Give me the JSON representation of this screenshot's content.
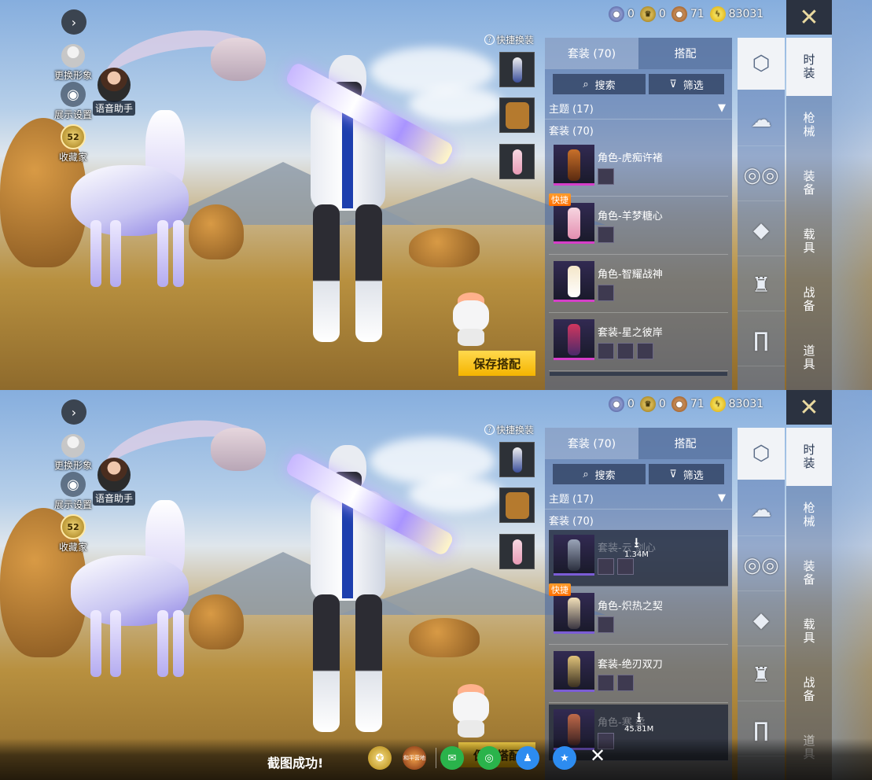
{
  "colors": {
    "accent_gold": "#f4b400",
    "panel_blue": "#48669e",
    "tag_orange": "#ff6d00",
    "rarity_pink": "#d63ec9",
    "rarity_purple": "#7b5cd6"
  },
  "top": {
    "currencies": [
      {
        "icon": "blue-coin-icon",
        "value": "0"
      },
      {
        "icon": "gold-medal-icon",
        "value": "0"
      },
      {
        "icon": "bronze-coin-icon",
        "value": "71"
      },
      {
        "icon": "lightning-coin-icon",
        "value": "83031"
      }
    ],
    "close_icon": "close-icon"
  },
  "left_menu": {
    "change_avatar": "更换形象",
    "display_settings": "展示设置",
    "collector": "收藏家",
    "collector_level": "52",
    "voice_assistant": "语音助手"
  },
  "quick_swap_label": "快捷换装",
  "save_label": "保存搭配",
  "list": {
    "tab_outfits": "套装 (70)",
    "tab_match": "搭配",
    "search": "搜索",
    "filter": "筛选",
    "theme": "主题 (17)",
    "section": "套装 (70)"
  },
  "categories": [
    "时装",
    "枪械",
    "装备",
    "载具",
    "战备",
    "道具"
  ],
  "panel1_items": [
    {
      "name": "角色-虎痴许褚",
      "tag": ""
    },
    {
      "name": "角色-羊梦糖心",
      "tag": "快捷"
    },
    {
      "name": "角色-智耀战神",
      "tag": ""
    },
    {
      "name": "套装-星之彼岸",
      "tag": ""
    }
  ],
  "panel2_items": [
    {
      "name": "套装-云    剑心",
      "download_size": "1.34M"
    },
    {
      "name": "角色-炽热之契",
      "tag": "快捷"
    },
    {
      "name": "套装-绝刃双刀"
    },
    {
      "name": "角色-寒    柔",
      "download_size": "45.81M"
    }
  ],
  "share_bar": {
    "message": "截图成功!",
    "icons": [
      "peace-elite-icon",
      "camp-app-icon",
      "wechat-icon",
      "moments-icon",
      "qq-icon",
      "qzone-icon"
    ],
    "camp_label": "和平营地"
  }
}
